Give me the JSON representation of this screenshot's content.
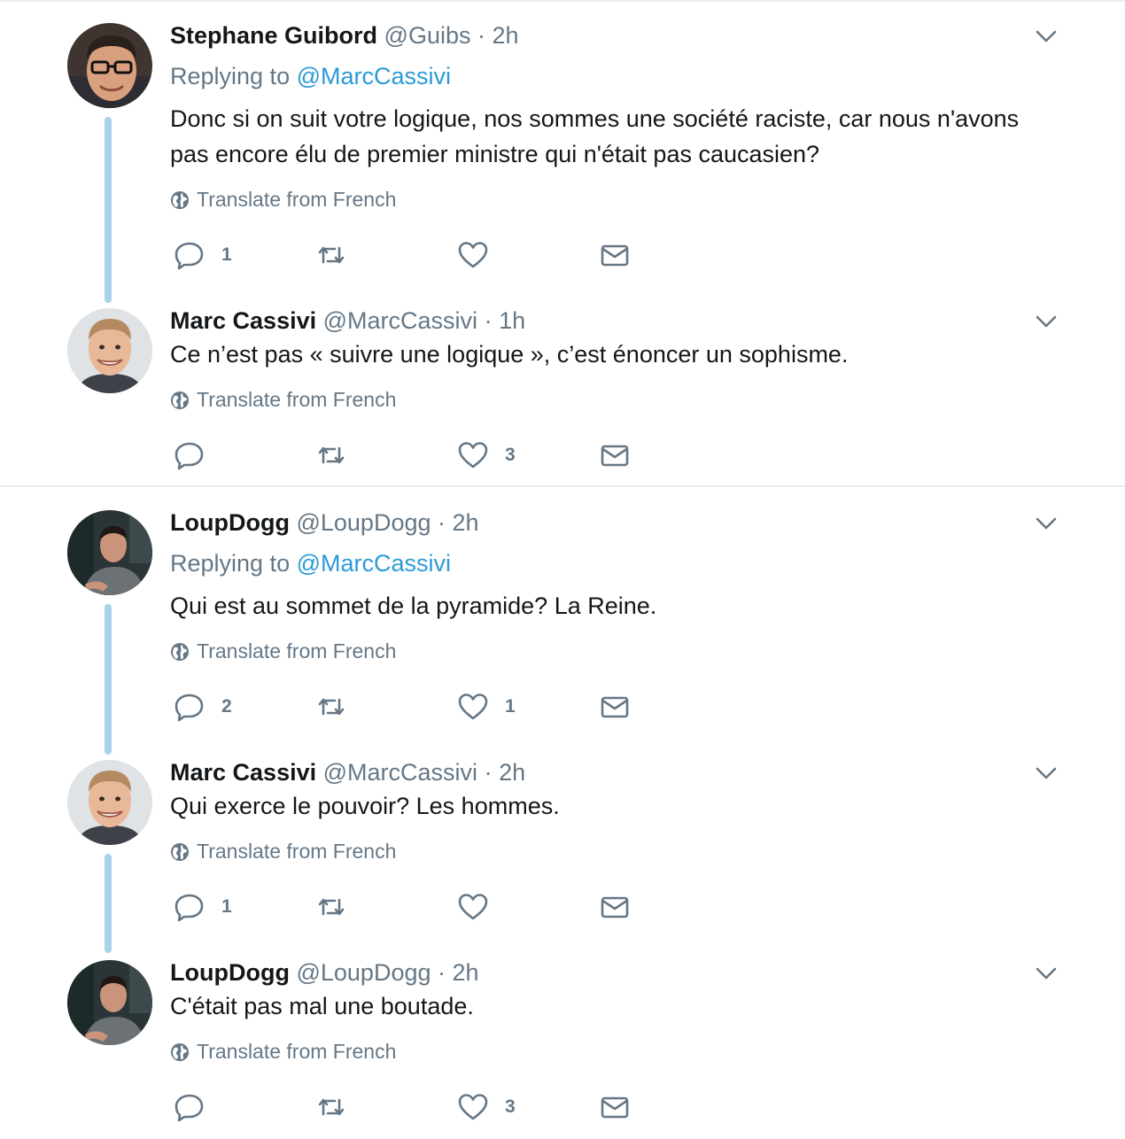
{
  "translate_label": "Translate from French",
  "colors": {
    "accent": "#2b9bd8",
    "thread_line": "#a9d3ea",
    "muted": "#657786",
    "divider": "#e6ecf0"
  },
  "tweets": [
    {
      "name": "Stephane Guibord",
      "handle": "@Guibs",
      "dot": "·",
      "time": "2h",
      "replying_prefix": "Replying to",
      "replying_to": "@MarcCassivi",
      "text": "Donc si on suit votre logique, nos sommes une société raciste, car nous n'avons pas encore élu de premier ministre qui n'était pas caucasien?",
      "reply_count": "1",
      "retweet_count": "",
      "like_count": "",
      "avatar_icon": "avatar-glasses-man"
    },
    {
      "name": "Marc Cassivi",
      "handle": "@MarcCassivi",
      "dot": "·",
      "time": "1h",
      "text": "Ce n’est pas « suivre une logique », c’est énoncer un sophisme.",
      "reply_count": "",
      "retweet_count": "",
      "like_count": "3",
      "avatar_icon": "avatar-smiling-man"
    },
    {
      "name": "LoupDogg",
      "handle": "@LoupDogg",
      "dot": "·",
      "time": "2h",
      "replying_prefix": "Replying to",
      "replying_to": "@MarcCassivi",
      "text": "Qui est au sommet de la pyramide? La Reine.",
      "reply_count": "2",
      "retweet_count": "",
      "like_count": "1",
      "avatar_icon": "avatar-dark-man"
    },
    {
      "name": "Marc Cassivi",
      "handle": "@MarcCassivi",
      "dot": "·",
      "time": "2h",
      "text": "Qui exerce le pouvoir? Les hommes.",
      "reply_count": "1",
      "retweet_count": "",
      "like_count": "",
      "avatar_icon": "avatar-smiling-man"
    },
    {
      "name": "LoupDogg",
      "handle": "@LoupDogg",
      "dot": "·",
      "time": "2h",
      "text": "C'était pas mal une boutade.",
      "reply_count": "",
      "retweet_count": "",
      "like_count": "3",
      "avatar_icon": "avatar-dark-man"
    }
  ]
}
